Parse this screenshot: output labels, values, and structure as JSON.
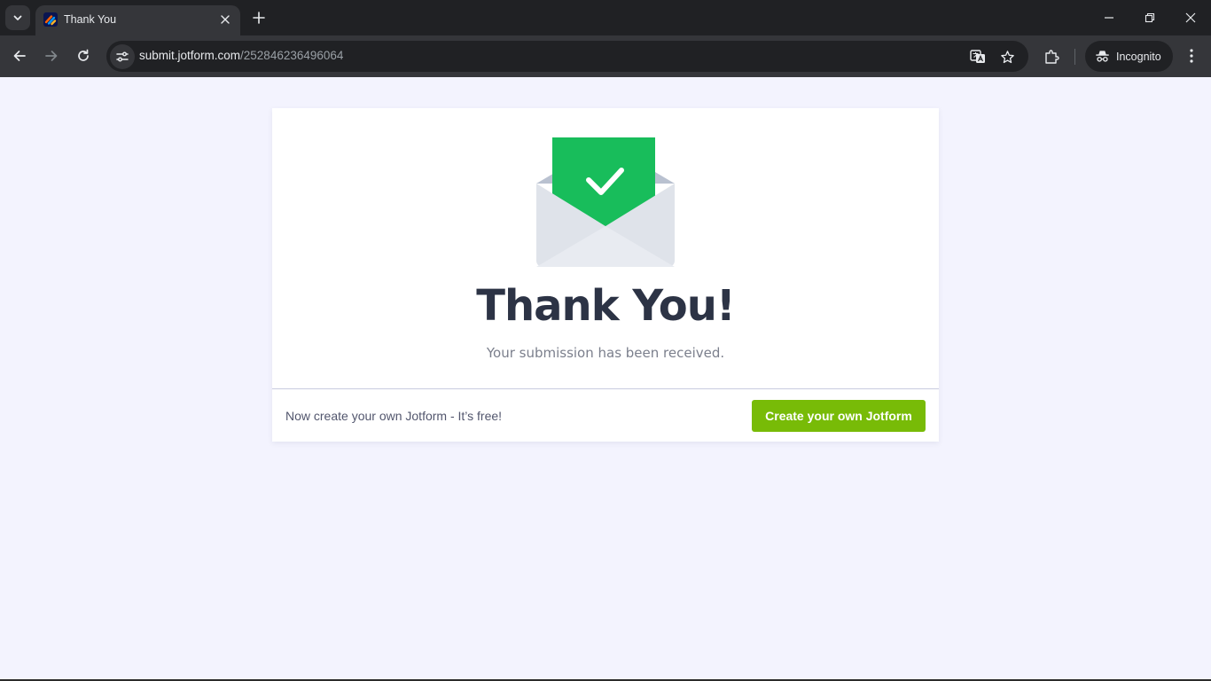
{
  "browser": {
    "tab": {
      "title": "Thank You",
      "favicon": "jotform-icon"
    },
    "address_bar": {
      "host": "submit.jotform.com",
      "path": "/252846236496064"
    },
    "profile": {
      "label": "Incognito"
    },
    "icons": [
      "tab-search-icon",
      "close-icon",
      "plus-icon",
      "minimize-icon",
      "restore-icon",
      "back-icon",
      "forward-icon",
      "reload-icon",
      "site-settings-icon",
      "translate-icon",
      "star-icon",
      "extensions-icon",
      "incognito-icon",
      "more-vert-icon"
    ]
  },
  "page": {
    "title": "Thank You!",
    "message": "Your submission has been received.",
    "footer": {
      "text": "Now create your own Jotform - It’s free!",
      "button_label": "Create your own Jotform"
    },
    "colors": {
      "background": "#f3f3fe",
      "card": "#ffffff",
      "check_green": "#18bd5b",
      "button_green": "#78bb07",
      "title": "#2c3345"
    }
  }
}
